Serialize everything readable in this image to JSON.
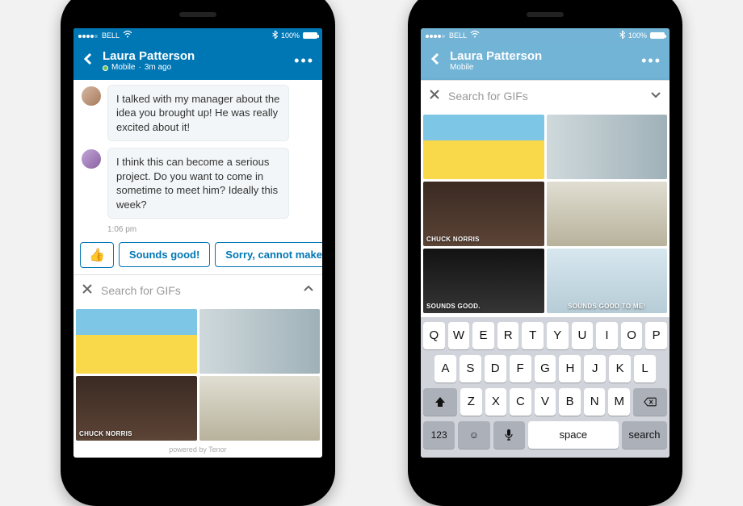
{
  "status": {
    "carrier": "BELL",
    "battery_pct": "100%"
  },
  "header": {
    "name": "Laura Patterson",
    "presence_label": "Mobile",
    "time_ago": "3m ago"
  },
  "messages": [
    {
      "text": "I talked with my manager about the idea you brought up! He was really excited about it!"
    },
    {
      "text": "I think this can become a serious project. Do you want to come in sometime to meet him? Ideally this week?"
    }
  ],
  "timestamp": "1:06 pm",
  "smart_replies": {
    "emoji": "👍",
    "option1": "Sounds good!",
    "option2": "Sorry, cannot make it"
  },
  "gif_search": {
    "placeholder": "Search for GIFs"
  },
  "gifs": {
    "norris_caption": "CHUCK NORRIS",
    "ferrell_caption": "SOUNDS GOOD.",
    "cat_caption": "SOUNDS GOOD TO ME!"
  },
  "powered_by": "powered by Tenor",
  "keyboard": {
    "row1": [
      "Q",
      "W",
      "E",
      "R",
      "T",
      "Y",
      "U",
      "I",
      "O",
      "P"
    ],
    "row2": [
      "A",
      "S",
      "D",
      "F",
      "G",
      "H",
      "J",
      "K",
      "L"
    ],
    "row3": [
      "Z",
      "X",
      "C",
      "V",
      "B",
      "N",
      "M"
    ],
    "num_key": "123",
    "space": "space",
    "search": "search"
  }
}
